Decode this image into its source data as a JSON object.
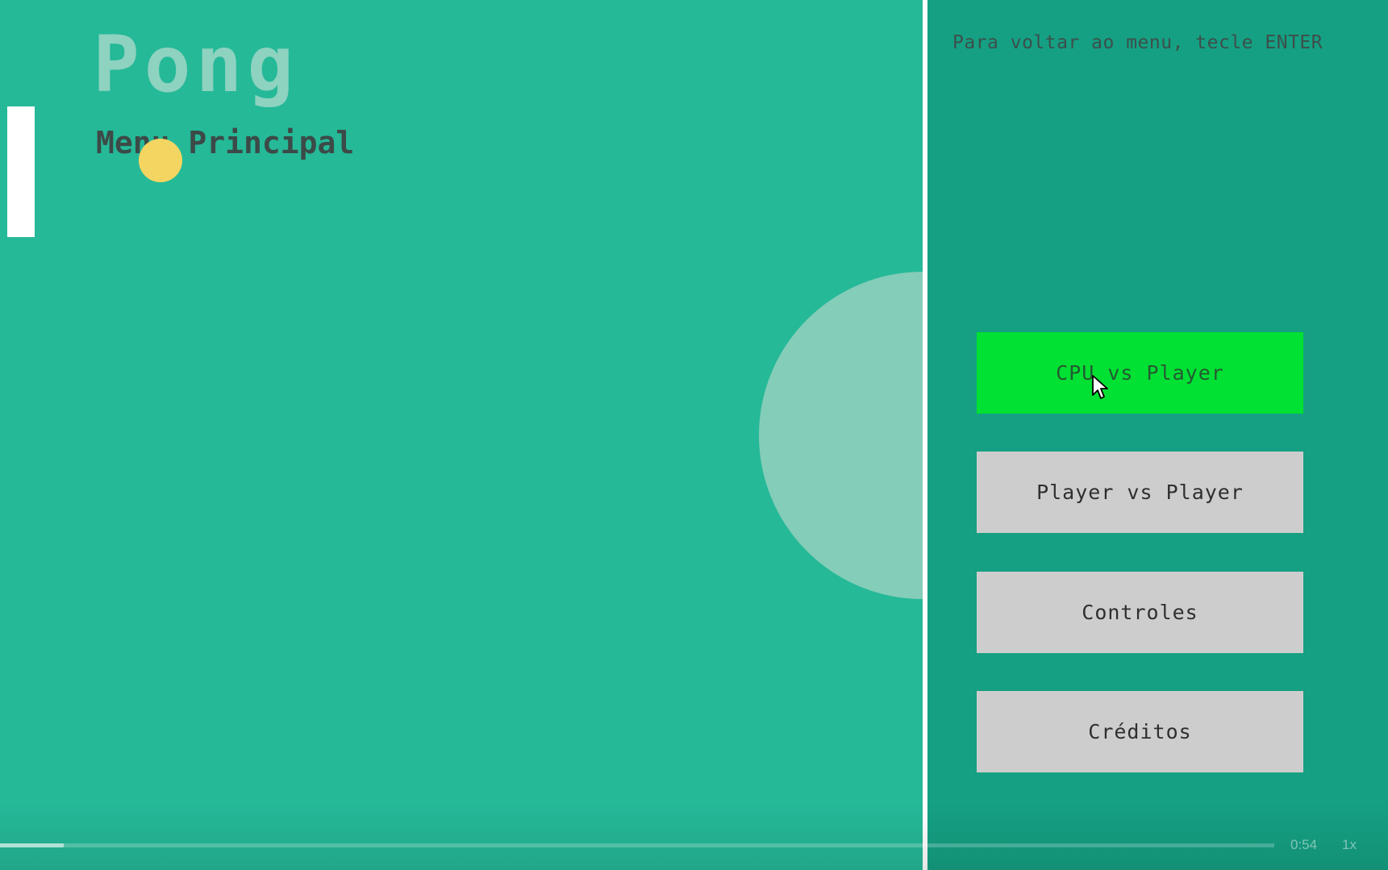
{
  "game": {
    "title": "Pong",
    "subtitle": "Menu Principal"
  },
  "menu": {
    "hint": "Para voltar ao menu, tecle ENTER",
    "buttons": [
      {
        "label": "CPU vs Player",
        "state": "hover"
      },
      {
        "label": "Player vs Player",
        "state": "default"
      },
      {
        "label": "Controles",
        "state": "default"
      },
      {
        "label": "Créditos",
        "state": "default"
      }
    ]
  },
  "player": {
    "time": "0:54",
    "speed": "1x",
    "progress": 0.05
  },
  "colors": {
    "field": "#25b998",
    "panel": "#15a083",
    "button_active": "#00e133",
    "button_default": "#cdcdcd",
    "ball": "#f5d561",
    "center_circle": "#84cdb8"
  },
  "icons": {
    "cursor": "mouse-pointer-icon"
  }
}
